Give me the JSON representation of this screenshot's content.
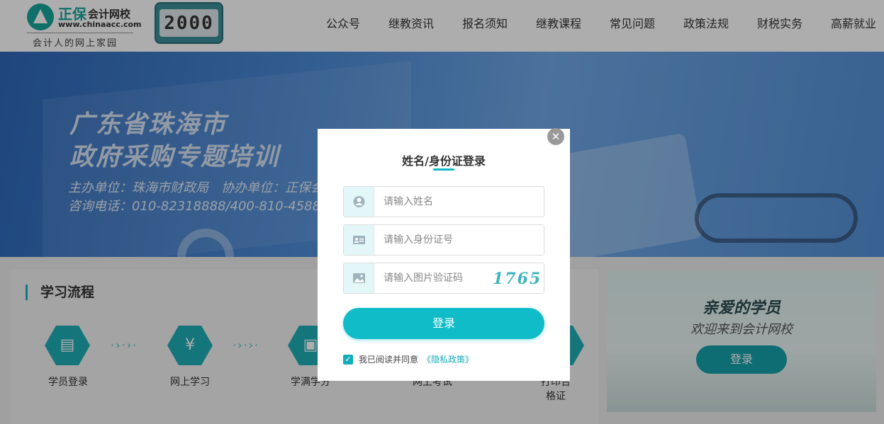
{
  "header": {
    "logo_brand": "正保",
    "logo_school": "会计网校",
    "logo_url": "www.chinaacc.com",
    "logo_slogan": "会计人的网上家园",
    "badge_text": "2000",
    "nav": [
      "公众号",
      "继教资讯",
      "报名须知",
      "继教课程",
      "常见问题",
      "政策法规",
      "财税实务",
      "高薪就业"
    ]
  },
  "banner": {
    "title_line1": "广东省珠海市",
    "title_line2": "政府采购专题培训",
    "host": "主办单位：珠海市财政局　协办单位：正保会",
    "phone": "咨询电话：010-82318888/400-810-4588"
  },
  "flow": {
    "title": "学习流程",
    "steps": [
      "学员登录",
      "网上学习",
      "学满学分",
      "网上考试",
      "打印合格证"
    ],
    "connector": "·›·›·"
  },
  "welcome": {
    "greeting": "亲爱的学员",
    "subtitle": "欢迎来到会计网校",
    "button": "登录"
  },
  "modal": {
    "close": "✕",
    "title": "姓名/身份证登录",
    "name_placeholder": "请输入姓名",
    "id_placeholder": "请输入身份证号",
    "captcha_placeholder": "请输入图片验证码",
    "captcha_code": "1765",
    "submit": "登录",
    "agree_text": "我已阅读并同意",
    "agree_link": "《隐私政策》",
    "agree_checked": true
  },
  "colors": {
    "accent": "#0fbcc7",
    "brand": "#1aa49b"
  },
  "icons": {
    "name_field": "user-icon",
    "id_field": "id-card-icon",
    "captcha_field": "image-icon"
  }
}
